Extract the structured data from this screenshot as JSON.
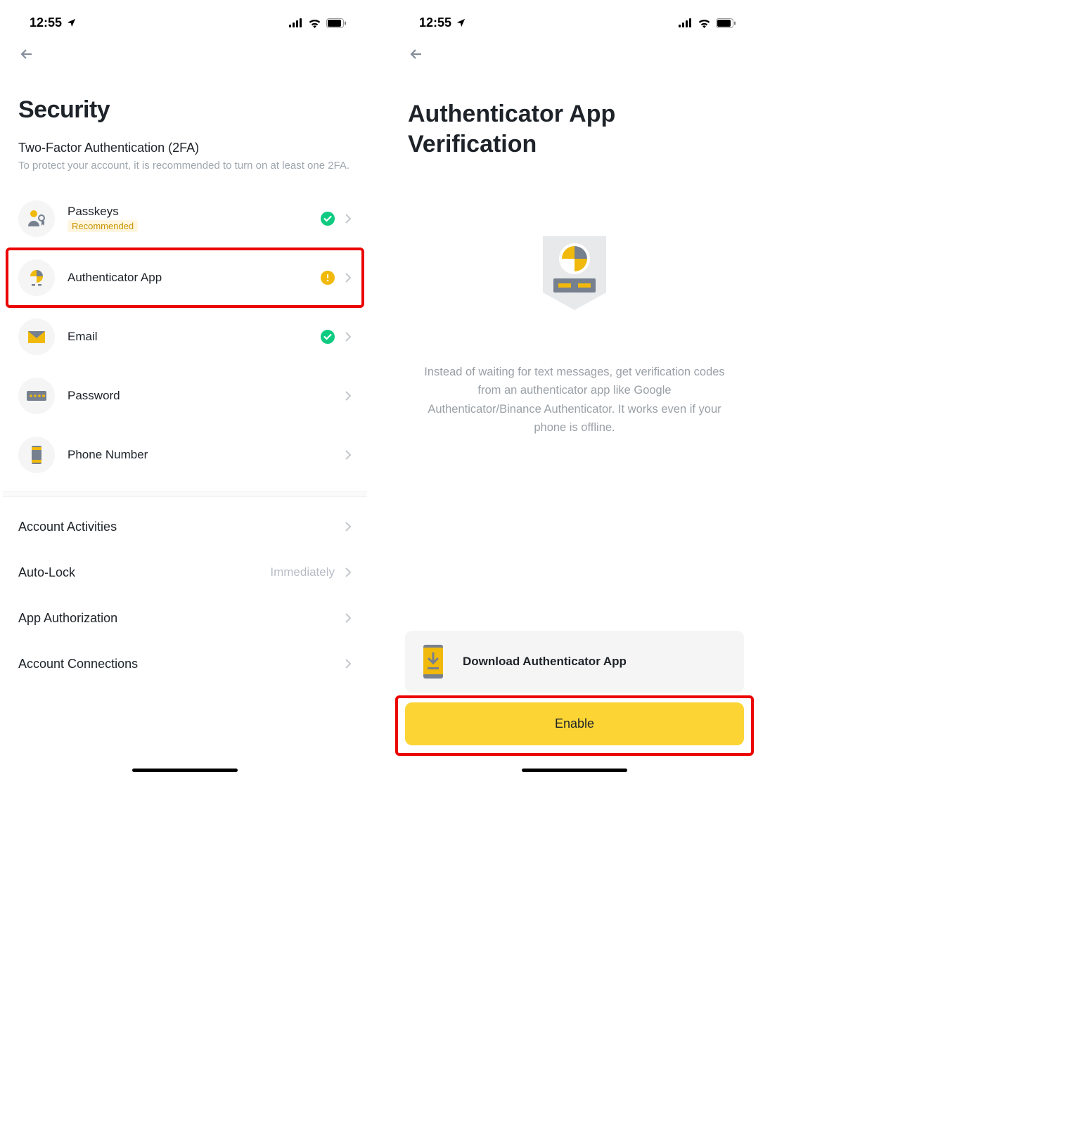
{
  "status": {
    "time": "12:55"
  },
  "screen1": {
    "title": "Security",
    "tfa_heading": "Two-Factor Authentication (2FA)",
    "tfa_sub": "To protect your account, it is recommended to turn on at least one 2FA.",
    "items": [
      {
        "label": "Passkeys",
        "tag": "Recommended"
      },
      {
        "label": "Authenticator App"
      },
      {
        "label": "Email"
      },
      {
        "label": "Password"
      },
      {
        "label": "Phone Number"
      }
    ],
    "settings": [
      {
        "label": "Account Activities",
        "value": ""
      },
      {
        "label": "Auto-Lock",
        "value": "Immediately"
      },
      {
        "label": "App Authorization",
        "value": ""
      },
      {
        "label": "Account Connections",
        "value": ""
      }
    ]
  },
  "screen2": {
    "title": "Authenticator App Verification",
    "desc": "Instead of waiting for text messages, get verification codes from an authenticator app like Google Authenticator/Binance Authenticator. It works even if your phone is offline.",
    "download_label": "Download Authenticator App",
    "enable_label": "Enable"
  }
}
